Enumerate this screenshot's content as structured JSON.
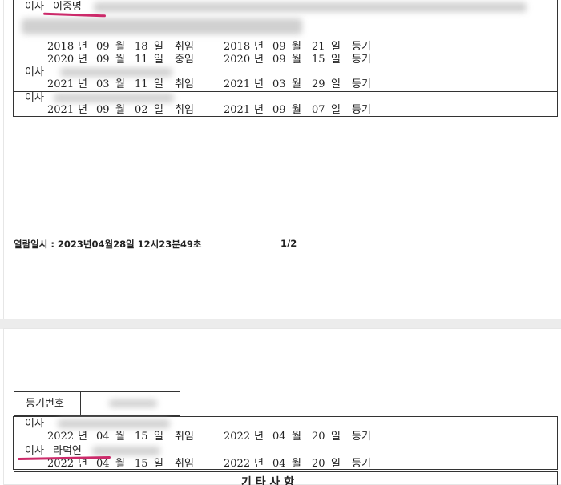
{
  "page1": {
    "officers": [
      {
        "title": "이사",
        "name": "이중명",
        "lines": [
          {
            "y1": "2018",
            "m1": "09",
            "d1": "18",
            "act1": "취임",
            "y2": "2018",
            "m2": "09",
            "d2": "21",
            "act2": "등기"
          },
          {
            "y1": "2020",
            "m1": "09",
            "d1": "11",
            "act1": "중임",
            "y2": "2020",
            "m2": "09",
            "d2": "15",
            "act2": "등기"
          }
        ]
      },
      {
        "title": "이사",
        "lines": [
          {
            "y1": "2021",
            "m1": "03",
            "d1": "11",
            "act1": "취임",
            "y2": "2021",
            "m2": "03",
            "d2": "29",
            "act2": "등기"
          }
        ]
      },
      {
        "title": "이사",
        "lines": [
          {
            "y1": "2021",
            "m1": "09",
            "d1": "02",
            "act1": "취임",
            "y2": "2021",
            "m2": "09",
            "d2": "07",
            "act2": "등기"
          }
        ]
      }
    ],
    "unit_year": "년",
    "unit_month": "월",
    "unit_day": "일",
    "footer": "열람일시 : 2023년04월28일 12시23분49초",
    "page_number": "1/2"
  },
  "page2": {
    "reg_label": "등기번호",
    "officers": [
      {
        "title": "이사",
        "lines": [
          {
            "y1": "2022",
            "m1": "04",
            "d1": "15",
            "act1": "취임",
            "y2": "2022",
            "m2": "04",
            "d2": "20",
            "act2": "등기"
          }
        ]
      },
      {
        "title": "이사",
        "name": "라덕연",
        "lines": [
          {
            "y1": "2022",
            "m1": "04",
            "d1": "15",
            "act1": "취임",
            "y2": "2022",
            "m2": "04",
            "d2": "20",
            "act2": "등기"
          }
        ]
      }
    ],
    "section_title": "기 타 사 항"
  },
  "colors": {
    "highlight_underline": "#cc2a6a",
    "redaction": "#c8c8c8"
  }
}
